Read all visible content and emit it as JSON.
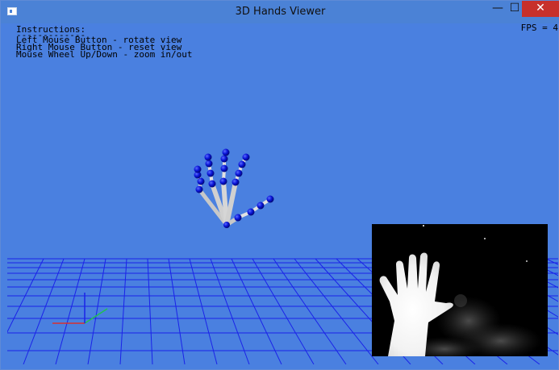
{
  "window": {
    "title": "3D Hands Viewer",
    "minimize_glyph": "—",
    "maximize_glyph": "☐",
    "close_glyph": "✕"
  },
  "overlay": {
    "instructions_title": "Instructions:",
    "instructions_underline": "-------------",
    "lines": [
      "Left Mouse Button - rotate view",
      "Right Mouse Button - reset view",
      "Mouse Wheel Up/Down - zoom in/out"
    ],
    "fps": "FPS = 4"
  },
  "colors": {
    "background": "#4a80e0",
    "grid": "#1a22e8",
    "joint": "#0a14d8",
    "bone": "#d8d8d8",
    "axis_x": "#d83030",
    "axis_y": "#20c050",
    "axis_z": "#1a22e8"
  },
  "icons": {
    "app": "app-window-icon"
  }
}
